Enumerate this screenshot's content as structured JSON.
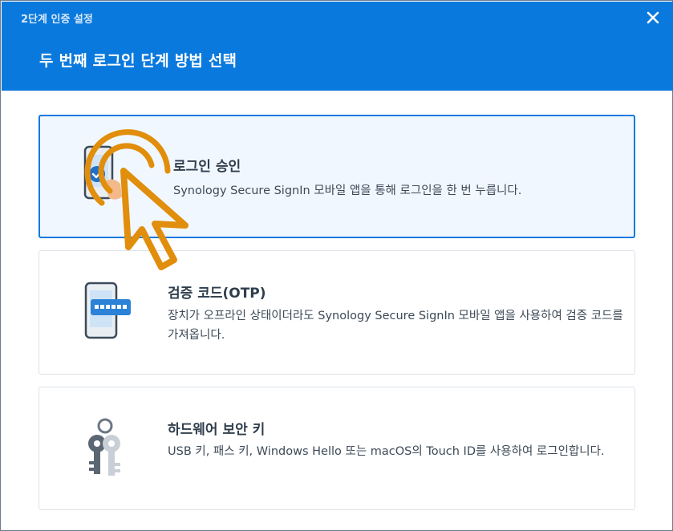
{
  "window": {
    "title": "2단계 인증 설정",
    "close_icon": "close-icon"
  },
  "header": {
    "title": "두 번째 로그인 단계 방법 선택",
    "background": "#0a79dd"
  },
  "options": [
    {
      "title": "로그인 승인",
      "description": "Synology Secure SignIn 모바일 앱을 통해 로그인을 한 번 누릅니다.",
      "icon": "phone-approve-icon",
      "selected": true
    },
    {
      "title": "검증 코드(OTP)",
      "description": "장치가 오프라인 상태이더라도 Synology Secure SignIn 모바일 앱을 사용하여 검증 코드를 가져옵니다.",
      "icon": "phone-otp-icon",
      "selected": false
    },
    {
      "title": "하드웨어 보안 키",
      "description": "USB 키, 패스 키, Windows Hello 또는 macOS의 Touch ID를 사용하여 로그인합니다.",
      "icon": "keys-icon",
      "selected": false
    }
  ],
  "colors": {
    "accent": "#0a79dd",
    "pointer_overlay": "#e08e0b"
  },
  "overlay_icon": "tap-pointer-icon"
}
